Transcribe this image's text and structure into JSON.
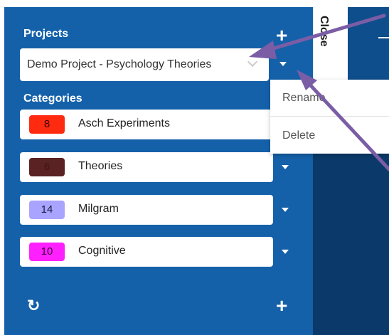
{
  "sidebar": {
    "projects_title": "Projects",
    "selected_project": "Demo Project - Psychology Theories",
    "categories_title": "Categories",
    "categories": [
      {
        "count": "8",
        "name": "Asch Experiments",
        "color": "#ff2b10",
        "text_color": "#3a0000"
      },
      {
        "count": "6",
        "name": "Theories",
        "color": "#5a2222",
        "text_color": "#3a1515"
      },
      {
        "count": "14",
        "name": "Milgram",
        "color": "#a9a4ff",
        "text_color": "#1c1c3a"
      },
      {
        "count": "10",
        "name": "Cognitive",
        "color": "#ff20ff",
        "text_color": "#3a003a"
      }
    ]
  },
  "menu": {
    "rename": "Rename",
    "delete": "Delete"
  },
  "panel": {
    "close_label": "Close"
  },
  "colors": {
    "sidebar_bg": "#1461aa",
    "dark_panel": "#0b3a6a",
    "annotation_arrow": "#7b5da6"
  },
  "icons": {
    "add_project": "plus-icon",
    "project_menu": "caret-down-icon",
    "refresh": "refresh-icon",
    "add_category": "plus-icon"
  }
}
